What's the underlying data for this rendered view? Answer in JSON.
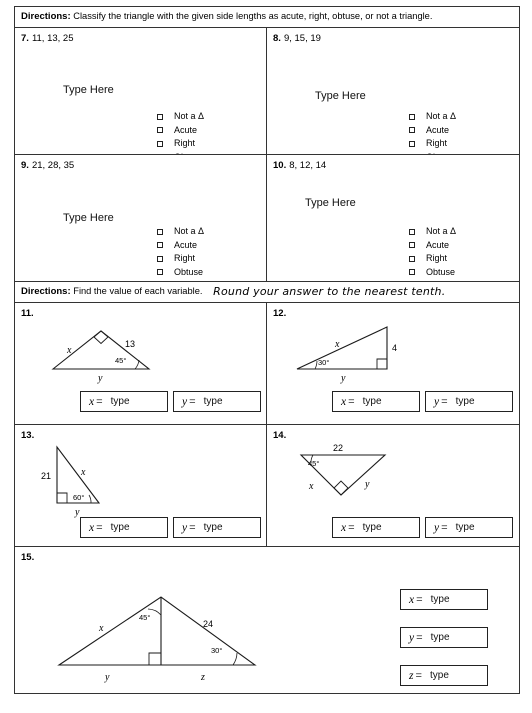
{
  "directions": {
    "label": "Directions:",
    "classify_text": "Classify the triangle with the given side lengths as acute, right, obtuse, or not a triangle.",
    "variable_text": "Find the value of each variable.",
    "handwritten_note": "Round your answer to the nearest tenth."
  },
  "common": {
    "type_here": "Type Here",
    "type_placeholder": "type",
    "equals": "=",
    "checkbox_icon": "empty-checkbox"
  },
  "choice_options": [
    "Not a Δ",
    "Acute",
    "Right",
    "Obtuse"
  ],
  "classification_problems": [
    {
      "number": "7.",
      "sides": "11, 13, 25"
    },
    {
      "number": "8.",
      "sides": "9, 15, 19"
    },
    {
      "number": "9.",
      "sides": "21, 28, 35"
    },
    {
      "number": "10.",
      "sides": "8, 12, 14"
    }
  ],
  "variable_problems": [
    {
      "number": "11.",
      "figure": {
        "type": "triangle-apex-right-angle",
        "labels": {
          "left_side": "x",
          "right_side": "13",
          "angle": "45°",
          "base": "y"
        }
      },
      "answers": [
        {
          "variable": "x",
          "value": "type"
        },
        {
          "variable": "y",
          "value": "type"
        }
      ]
    },
    {
      "number": "12.",
      "figure": {
        "type": "right-triangle-vertical-leg",
        "labels": {
          "hypotenuse": "x",
          "vertical_leg": "4",
          "angle": "30°",
          "base": "y"
        }
      },
      "answers": [
        {
          "variable": "x",
          "value": "type"
        },
        {
          "variable": "y",
          "value": "type"
        }
      ]
    },
    {
      "number": "13.",
      "figure": {
        "type": "right-triangle-tall",
        "labels": {
          "vertical_leg": "21",
          "hypotenuse": "x",
          "angle": "60°",
          "base": "y"
        }
      },
      "answers": [
        {
          "variable": "x",
          "value": "type"
        },
        {
          "variable": "y",
          "value": "type"
        }
      ]
    },
    {
      "number": "14.",
      "figure": {
        "type": "inverted-triangle-right-angle",
        "labels": {
          "top_side": "22",
          "angle": "45°",
          "left_side": "x",
          "right_side": "y"
        }
      },
      "answers": [
        {
          "variable": "x",
          "value": "type"
        },
        {
          "variable": "y",
          "value": "type"
        }
      ]
    },
    {
      "number": "15.",
      "figure": {
        "type": "triangle-with-altitude",
        "labels": {
          "left_side": "x",
          "apex_angle": "45°",
          "right_side": "24",
          "right_angle_label": "30°",
          "base_left": "y",
          "base_right": "z"
        }
      },
      "answers": [
        {
          "variable": "x",
          "value": "type"
        },
        {
          "variable": "y",
          "value": "type"
        },
        {
          "variable": "z",
          "value": "type"
        }
      ]
    }
  ]
}
